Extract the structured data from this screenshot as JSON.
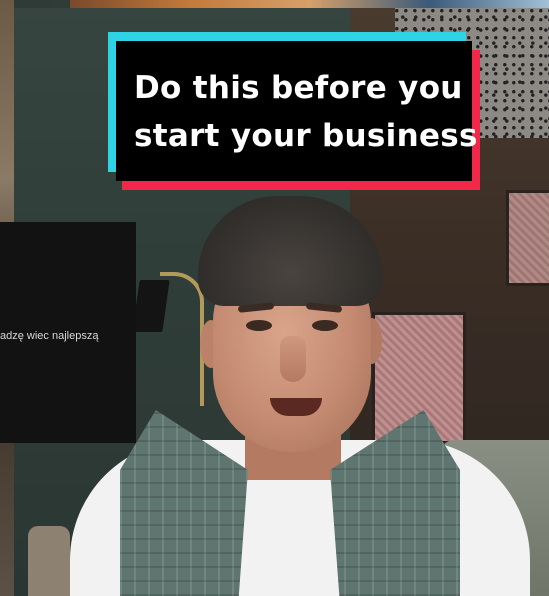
{
  "caption": {
    "line1": "Do this before you",
    "line2": "start your business",
    "colors": {
      "box": "#000000",
      "text": "#ffffff",
      "accent_cyan": "#2fd3e6",
      "accent_red": "#f2284b"
    }
  },
  "overlay": {
    "text": "adzę wiec najlepszą"
  }
}
